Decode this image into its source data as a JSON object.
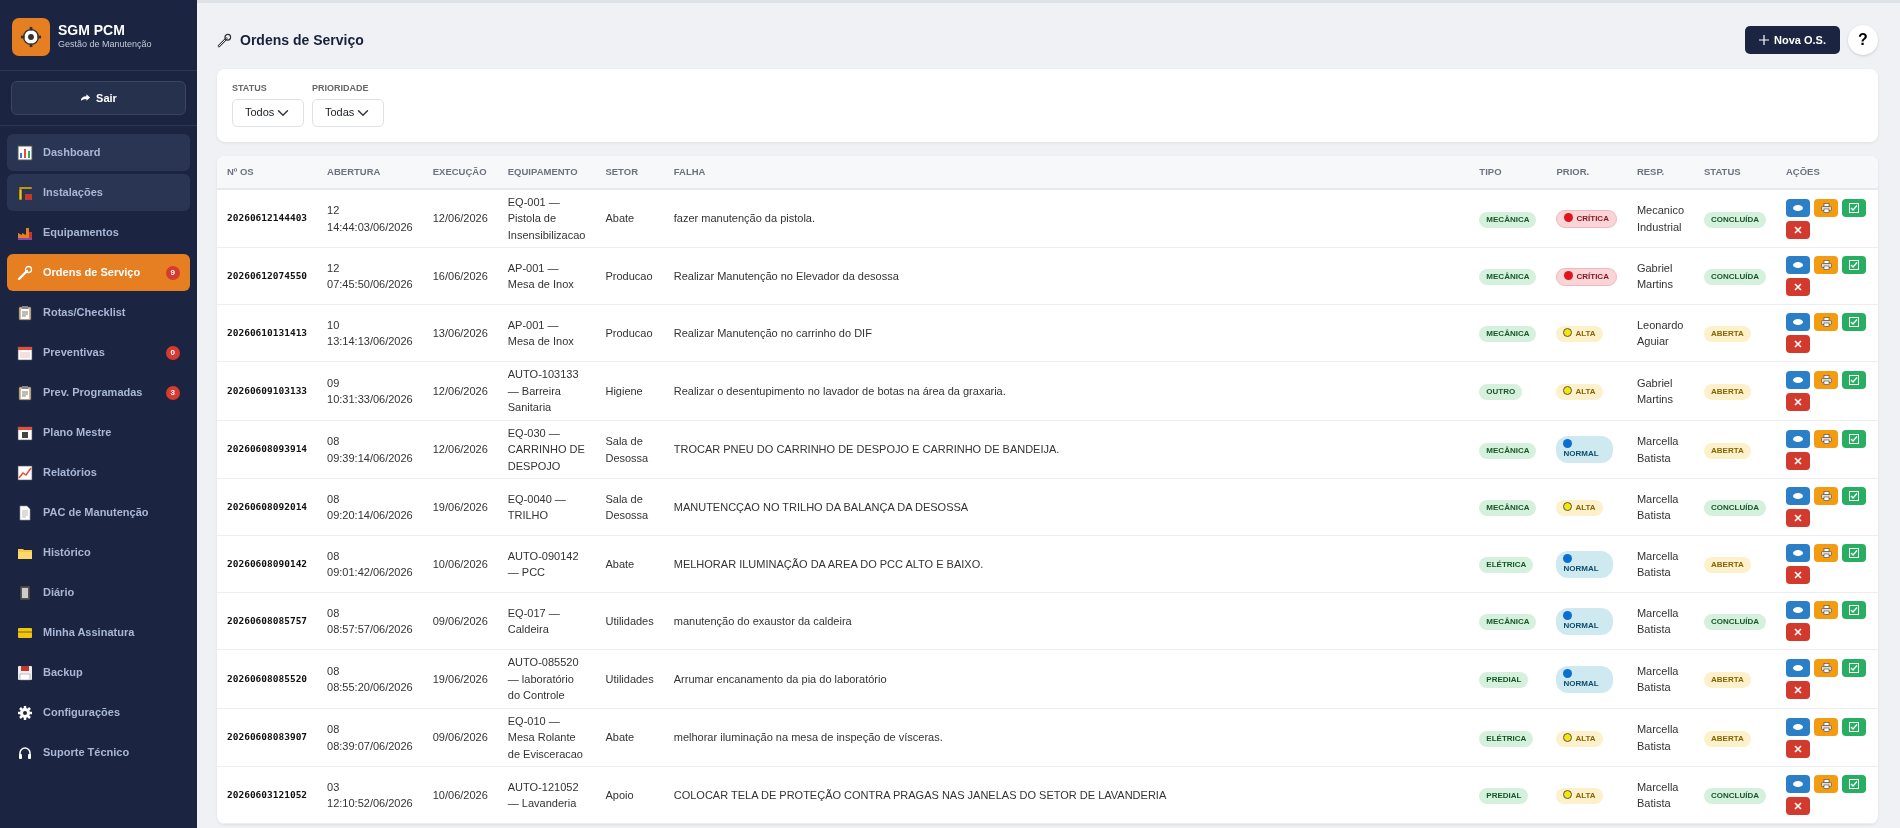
{
  "brand": {
    "title": "SGM PCM",
    "subtitle": "Gestão de Manutenção"
  },
  "logout": {
    "label": "Sair"
  },
  "sidebar": {
    "items": [
      {
        "label": "Dashboard",
        "selected": false,
        "highlighted": true
      },
      {
        "label": "Instalações",
        "selected": false,
        "highlighted": true
      },
      {
        "label": "Equipamentos",
        "selected": false,
        "highlighted": false
      },
      {
        "label": "Ordens de Serviço",
        "selected": true,
        "highlighted": false,
        "badge": "9"
      },
      {
        "label": "Rotas/Checklist",
        "selected": false,
        "highlighted": false
      },
      {
        "label": "Preventivas",
        "selected": false,
        "highlighted": false,
        "badge": "0"
      },
      {
        "label": "Prev. Programadas",
        "selected": false,
        "highlighted": false,
        "badge": "3"
      },
      {
        "label": "Plano Mestre",
        "selected": false,
        "highlighted": false
      },
      {
        "label": "Relatórios",
        "selected": false,
        "highlighted": false
      },
      {
        "label": "PAC de Manutenção",
        "selected": false,
        "highlighted": false
      },
      {
        "label": "Histórico",
        "selected": false,
        "highlighted": false
      },
      {
        "label": "Diário",
        "selected": false,
        "highlighted": false
      },
      {
        "label": "Minha Assinatura",
        "selected": false,
        "highlighted": false
      },
      {
        "label": "Backup",
        "selected": false,
        "highlighted": false
      },
      {
        "label": "Configurações",
        "selected": false,
        "highlighted": false
      },
      {
        "label": "Suporte Técnico",
        "selected": false,
        "highlighted": false
      }
    ]
  },
  "page": {
    "title": "Ordens de Serviço",
    "new_button": "Nova O.S.",
    "help_button": "?"
  },
  "filters": [
    {
      "label": "STATUS",
      "value": "Todos"
    },
    {
      "label": "PRIORIDADE",
      "value": "Todas"
    }
  ],
  "table": {
    "columns": [
      "Nº OS",
      "ABERTURA",
      "EXECUÇÃO",
      "EQUIPAMENTO",
      "SETOR",
      "FALHA",
      "TIPO",
      "PRIOR.",
      "RESP.",
      "STATUS",
      "AÇÕES"
    ],
    "rows": [
      {
        "os": "20260612144403",
        "abertura": [
          "12",
          "14:44:03/06/2026"
        ],
        "execucao": "12/06/2026",
        "equipamento": "EQ-001 — Pistola de Insensibilizacao",
        "setor": "Abate",
        "falha": "fazer manutenção da pistola.",
        "tipo": "MECÂNICA",
        "prioridade": {
          "label": "CRÍTICA",
          "kind": "critica"
        },
        "responsavel": "Mecanico Industrial",
        "status": {
          "label": "CONCLUÍDA",
          "kind": "concluida"
        }
      },
      {
        "os": "20260612074550",
        "abertura": [
          "12",
          "07:45:50/06/2026"
        ],
        "execucao": "16/06/2026",
        "equipamento": "AP-001 — Mesa de Inox",
        "setor": "Producao",
        "falha": "Realizar Manutenção no Elevador da desossa",
        "tipo": "MECÂNICA",
        "prioridade": {
          "label": "CRÍTICA",
          "kind": "critica"
        },
        "responsavel": "Gabriel Martins",
        "status": {
          "label": "CONCLUÍDA",
          "kind": "concluida"
        }
      },
      {
        "os": "20260610131413",
        "abertura": [
          "10",
          "13:14:13/06/2026"
        ],
        "execucao": "13/06/2026",
        "equipamento": "AP-001 — Mesa de Inox",
        "setor": "Producao",
        "falha": "Realizar Manutenção no carrinho do DIF",
        "tipo": "MECÂNICA",
        "prioridade": {
          "label": "ALTA",
          "kind": "alta"
        },
        "responsavel": "Leonardo Aguiar",
        "status": {
          "label": "ABERTA",
          "kind": "aberta"
        }
      },
      {
        "os": "20260609103133",
        "abertura": [
          "09",
          "10:31:33/06/2026"
        ],
        "execucao": "12/06/2026",
        "equipamento": "AUTO-103133 — Barreira Sanitaria",
        "setor": "Higiene",
        "falha": "Realizar o desentupimento no lavador de botas na área da graxaria.",
        "tipo": "OUTRO",
        "prioridade": {
          "label": "ALTA",
          "kind": "alta"
        },
        "responsavel": "Gabriel Martins",
        "status": {
          "label": "ABERTA",
          "kind": "aberta"
        }
      },
      {
        "os": "20260608093914",
        "abertura": [
          "08",
          "09:39:14/06/2026"
        ],
        "execucao": "12/06/2026",
        "equipamento": "EQ-030 — CARRINHO DE DESPOJO",
        "setor": "Sala de Desossa",
        "falha": "TROCAR PNEU DO CARRINHO DE DESPOJO E CARRINHO DE BANDEIJA.",
        "tipo": "MECÂNICA",
        "prioridade": {
          "label": "NORMAL",
          "kind": "normal"
        },
        "responsavel": "Marcella Batista",
        "status": {
          "label": "ABERTA",
          "kind": "aberta"
        }
      },
      {
        "os": "20260608092014",
        "abertura": [
          "08",
          "09:20:14/06/2026"
        ],
        "execucao": "19/06/2026",
        "equipamento": "EQ-0040 — TRILHO",
        "setor": "Sala de Desossa",
        "falha": "MANUTENCÇAO NO TRILHO DA BALANÇA DA DESOSSA",
        "tipo": "MECÂNICA",
        "prioridade": {
          "label": "ALTA",
          "kind": "alta"
        },
        "responsavel": "Marcella Batista",
        "status": {
          "label": "CONCLUÍDA",
          "kind": "concluida"
        }
      },
      {
        "os": "20260608090142",
        "abertura": [
          "08",
          "09:01:42/06/2026"
        ],
        "execucao": "10/06/2026",
        "equipamento": "AUTO-090142 — PCC",
        "setor": "Abate",
        "falha": "MELHORAR ILUMINAÇÃO DA AREA DO PCC ALTO E BAIXO.",
        "tipo": "ELÉTRICA",
        "prioridade": {
          "label": "NORMAL",
          "kind": "normal"
        },
        "responsavel": "Marcella Batista",
        "status": {
          "label": "ABERTA",
          "kind": "aberta"
        }
      },
      {
        "os": "20260608085757",
        "abertura": [
          "08",
          "08:57:57/06/2026"
        ],
        "execucao": "09/06/2026",
        "equipamento": "EQ-017 — Caldeira",
        "setor": "Utilidades",
        "falha": "manutenção do exaustor da caldeira",
        "tipo": "MECÂNICA",
        "prioridade": {
          "label": "NORMAL",
          "kind": "normal"
        },
        "responsavel": "Marcella Batista",
        "status": {
          "label": "CONCLUÍDA",
          "kind": "concluida"
        }
      },
      {
        "os": "20260608085520",
        "abertura": [
          "08",
          "08:55:20/06/2026"
        ],
        "execucao": "19/06/2026",
        "equipamento": "AUTO-085520 — laboratório do Controle",
        "setor": "Utilidades",
        "falha": "Arrumar encanamento da pia do laboratório",
        "tipo": "PREDIAL",
        "prioridade": {
          "label": "NORMAL",
          "kind": "normal"
        },
        "responsavel": "Marcella Batista",
        "status": {
          "label": "ABERTA",
          "kind": "aberta"
        }
      },
      {
        "os": "20260608083907",
        "abertura": [
          "08",
          "08:39:07/06/2026"
        ],
        "execucao": "09/06/2026",
        "equipamento": "EQ-010 — Mesa Rolante de Evisceracao",
        "setor": "Abate",
        "falha": "melhorar iluminação na mesa de inspeção de vísceras.",
        "tipo": "ELÉTRICA",
        "prioridade": {
          "label": "ALTA",
          "kind": "alta"
        },
        "responsavel": "Marcella Batista",
        "status": {
          "label": "ABERTA",
          "kind": "aberta"
        }
      },
      {
        "os": "20260603121052",
        "abertura": [
          "03",
          "12:10:52/06/2026"
        ],
        "execucao": "10/06/2026",
        "equipamento": "AUTO-121052 — Lavanderia",
        "setor": "Apoio",
        "falha": "COLOCAR TELA DE PROTEÇÃO CONTRA PRAGAS NAS JANELAS DO SETOR DE LAVANDERIA",
        "tipo": "PREDIAL",
        "prioridade": {
          "label": "ALTA",
          "kind": "alta"
        },
        "responsavel": "Marcella Batista",
        "status": {
          "label": "CONCLUÍDA",
          "kind": "concluida"
        }
      }
    ]
  }
}
